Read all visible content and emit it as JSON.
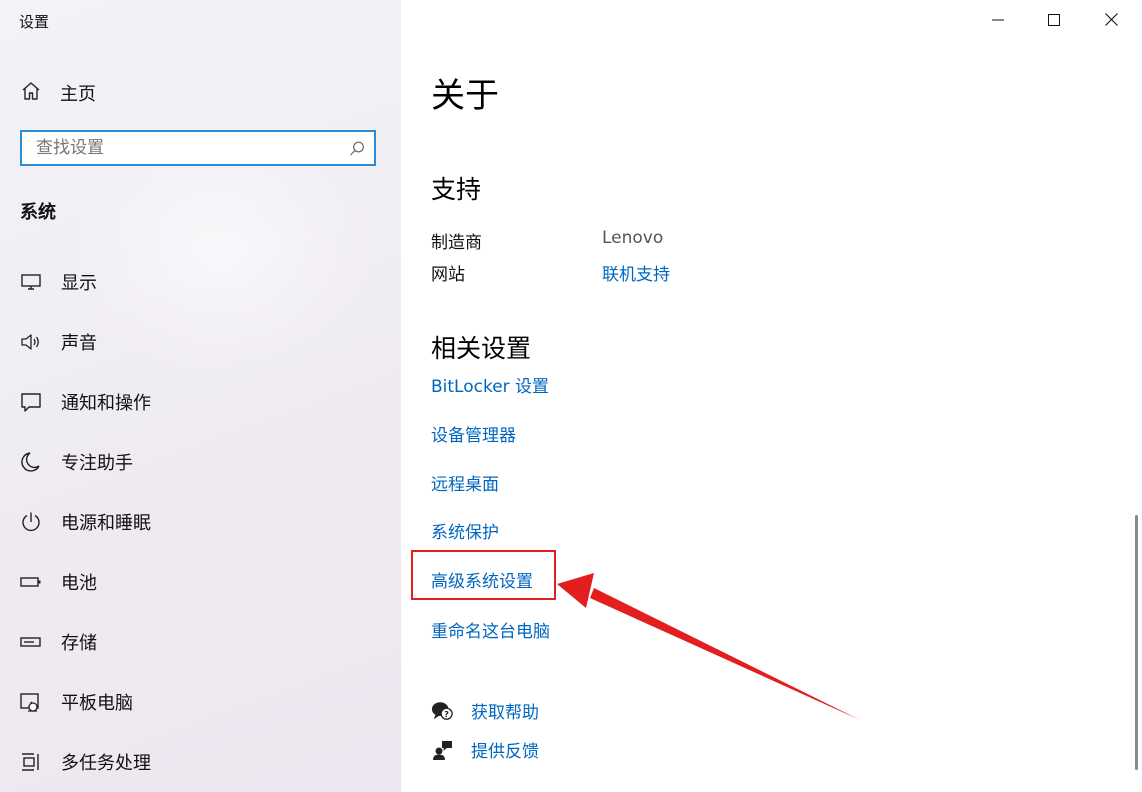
{
  "window": {
    "title": "设置",
    "controls": {
      "minimize": "minimize",
      "maximize": "maximize",
      "close": "close"
    }
  },
  "sidebar": {
    "home": {
      "label": "主页",
      "icon": "home-icon"
    },
    "search": {
      "placeholder": "查找设置",
      "value": ""
    },
    "section_label": "系统",
    "items": [
      {
        "label": "显示",
        "icon": "monitor-icon"
      },
      {
        "label": "声音",
        "icon": "speaker-icon"
      },
      {
        "label": "通知和操作",
        "icon": "notification-icon"
      },
      {
        "label": "专注助手",
        "icon": "moon-icon"
      },
      {
        "label": "电源和睡眠",
        "icon": "power-icon"
      },
      {
        "label": "电池",
        "icon": "battery-icon"
      },
      {
        "label": "存储",
        "icon": "storage-icon"
      },
      {
        "label": "平板电脑",
        "icon": "tablet-icon"
      },
      {
        "label": "多任务处理",
        "icon": "multitask-icon"
      }
    ]
  },
  "main": {
    "page_title": "关于",
    "support": {
      "heading": "支持",
      "manufacturer_label": "制造商",
      "manufacturer_value": "Lenovo",
      "website_label": "网站",
      "website_link": "联机支持"
    },
    "related": {
      "heading": "相关设置",
      "links": [
        "BitLocker 设置",
        "设备管理器",
        "远程桌面",
        "系统保护",
        "高级系统设置",
        "重命名这台电脑"
      ],
      "highlighted_link": "高级系统设置"
    },
    "help": {
      "get_help": "获取帮助",
      "feedback": "提供反馈"
    }
  },
  "colors": {
    "accent": "#0067c0",
    "search_border": "#2b8dd6",
    "annotation_red": "#e21e1e"
  }
}
